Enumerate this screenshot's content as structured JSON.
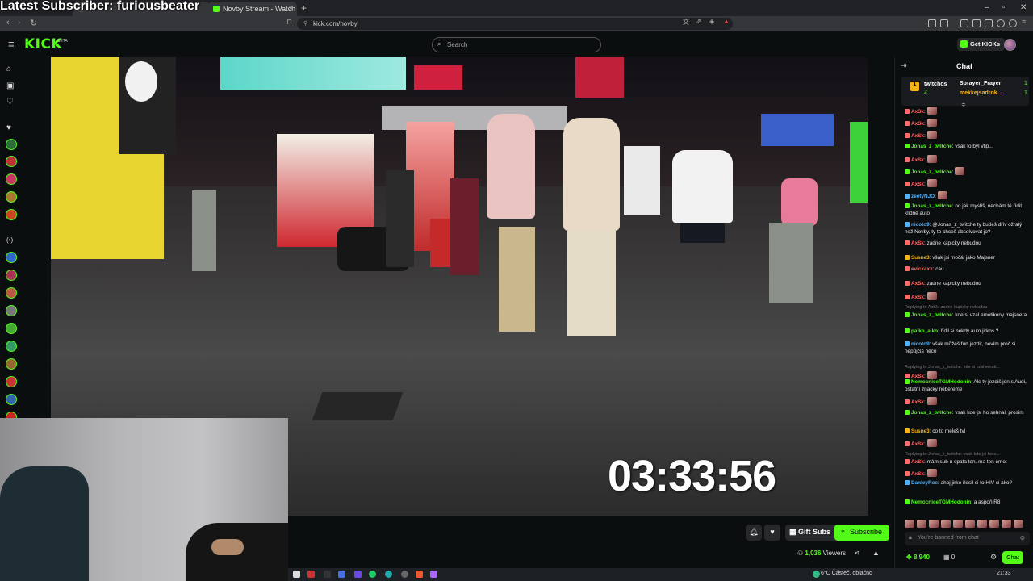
{
  "overlay": {
    "text": "Latest Subscriber: furiousbeater"
  },
  "browser": {
    "tabs": [
      {
        "label": "Novby Stream - Watch Live o..."
      }
    ],
    "url": "kick.com/novby"
  },
  "header": {
    "logo": "KICK",
    "logo_badge": "BETA",
    "search_placeholder": "Search",
    "get_kicks_label": "Get KICKs"
  },
  "video": {
    "timer": "03:33:56"
  },
  "stream_actions": {
    "gift_subs_label": "Gift Subs",
    "subscribe_label": "Subscribe",
    "viewers_count": "1,036",
    "viewers_label": "Viewers"
  },
  "chat": {
    "title": "Chat",
    "pinned": {
      "user": "twitchos",
      "count": "2",
      "entries": [
        {
          "name": "Sprayer_Frayer",
          "value": "1"
        },
        {
          "name": "mekkejsadrok...",
          "value": "1"
        }
      ]
    },
    "messages": [
      {
        "user": "AxSk",
        "text": "",
        "color": "#ff6b6b"
      },
      {
        "user": "AxSk",
        "text": "",
        "color": "#ff6b6b"
      },
      {
        "user": "AxSk",
        "text": "",
        "color": "#ff6b6b"
      },
      {
        "user": "Jonas_z_twitche",
        "text": "vsak to byl vtip...",
        "color": "#53fc18"
      },
      {
        "user": "AxSk",
        "text": "",
        "color": "#ff6b6b"
      },
      {
        "user": "Jonas_z_twitche",
        "text": "",
        "color": "#53fc18"
      },
      {
        "user": "AxSk",
        "text": "",
        "color": "#ff6b6b"
      },
      {
        "user": "zeetyNJO",
        "text": "",
        "color": "#4fb3ff"
      },
      {
        "user": "Jonas_z_twitche",
        "text": "no jak myslíš, nechám tě řídit klidně auto",
        "color": "#53fc18"
      },
      {
        "user": "nicoto9",
        "text": "@Jonas_z_twitche ty budeš dřív ožralý než Novby, ty to chceš absolvovat jo?",
        "color": "#4fb3ff"
      },
      {
        "user": "AxSk",
        "text": "zadne kapicky nebudou",
        "color": "#ff6b6b"
      },
      {
        "user": "Susne3",
        "text": "však jsi močál jako Majsner",
        "color": "#f5b315"
      },
      {
        "user": "evickaxx",
        "text": "cau",
        "color": "#ff6b6b"
      },
      {
        "user": "AxSk",
        "text": "zadne kapicky nebudou",
        "color": "#ff6b6b"
      },
      {
        "user": "AxSk",
        "text": "",
        "color": "#ff6b6b"
      },
      {
        "reply": "Replying to AxSk: zadne kapicky nebudou",
        "user": "Jonas_z_twitche",
        "text": "kde si vzal emotikony majsnera",
        "color": "#53fc18"
      },
      {
        "user": "palko_aiko",
        "text": "řídil si nekdy auto jirkos ?",
        "color": "#53fc18"
      },
      {
        "user": "nicoto9",
        "text": "však můžeš furt jezdit, nevím proč si nepůjčíš něco",
        "color": "#4fb3ff"
      },
      {
        "reply": "Replying to Jonas_z_twitche: kde si vzal emoti...",
        "user": "AxSk",
        "text": "",
        "color": "#ff6b6b"
      },
      {
        "user": "NemocniceTGMHodonin",
        "text": "Ale ty jezdiš jen s Audi, ostatní značky nebereme",
        "color": "#53fc18"
      },
      {
        "user": "AxSk",
        "text": "",
        "color": "#ff6b6b"
      },
      {
        "user": "Jonas_z_twitche",
        "text": "vsak kde jsi ho sehnal, prosim",
        "color": "#53fc18"
      },
      {
        "user": "Susne3",
        "text": "co to meleš tvl",
        "color": "#f5b315"
      },
      {
        "user": "AxSk",
        "text": "",
        "color": "#ff6b6b"
      },
      {
        "reply": "Replying to Jonas_z_twitche: vsak kde jsi ho s...",
        "user": "AxSk",
        "text": "mám sub u opata ten. ma ten emot",
        "color": "#ff6b6b"
      },
      {
        "user": "AxSk",
        "text": "",
        "color": "#ff6b6b"
      },
      {
        "user": "DanleyRoe",
        "text": "ahoj jirko řlesil si to HIV ci ako?",
        "color": "#4fb3ff"
      },
      {
        "user": "NemocniceTGMHodonin",
        "text": "a aspoň R8",
        "color": "#53fc18"
      }
    ],
    "input_placeholder": "You're banned from chat",
    "kicks_balance": "8,940",
    "subs_count": "0",
    "send_label": "Chat"
  },
  "taskbar": {
    "weather": "6°C  Částeč. oblačno",
    "clock": "21:33"
  },
  "colors": {
    "brand": "#53fc18",
    "bg": "#0b0e0f"
  },
  "icons": [
    "home-icon",
    "browse-icon",
    "following-icon",
    "search-icon",
    "bell-icon",
    "heart-icon",
    "gift-icon",
    "share-icon",
    "report-icon",
    "settings-icon",
    "send-icon"
  ]
}
